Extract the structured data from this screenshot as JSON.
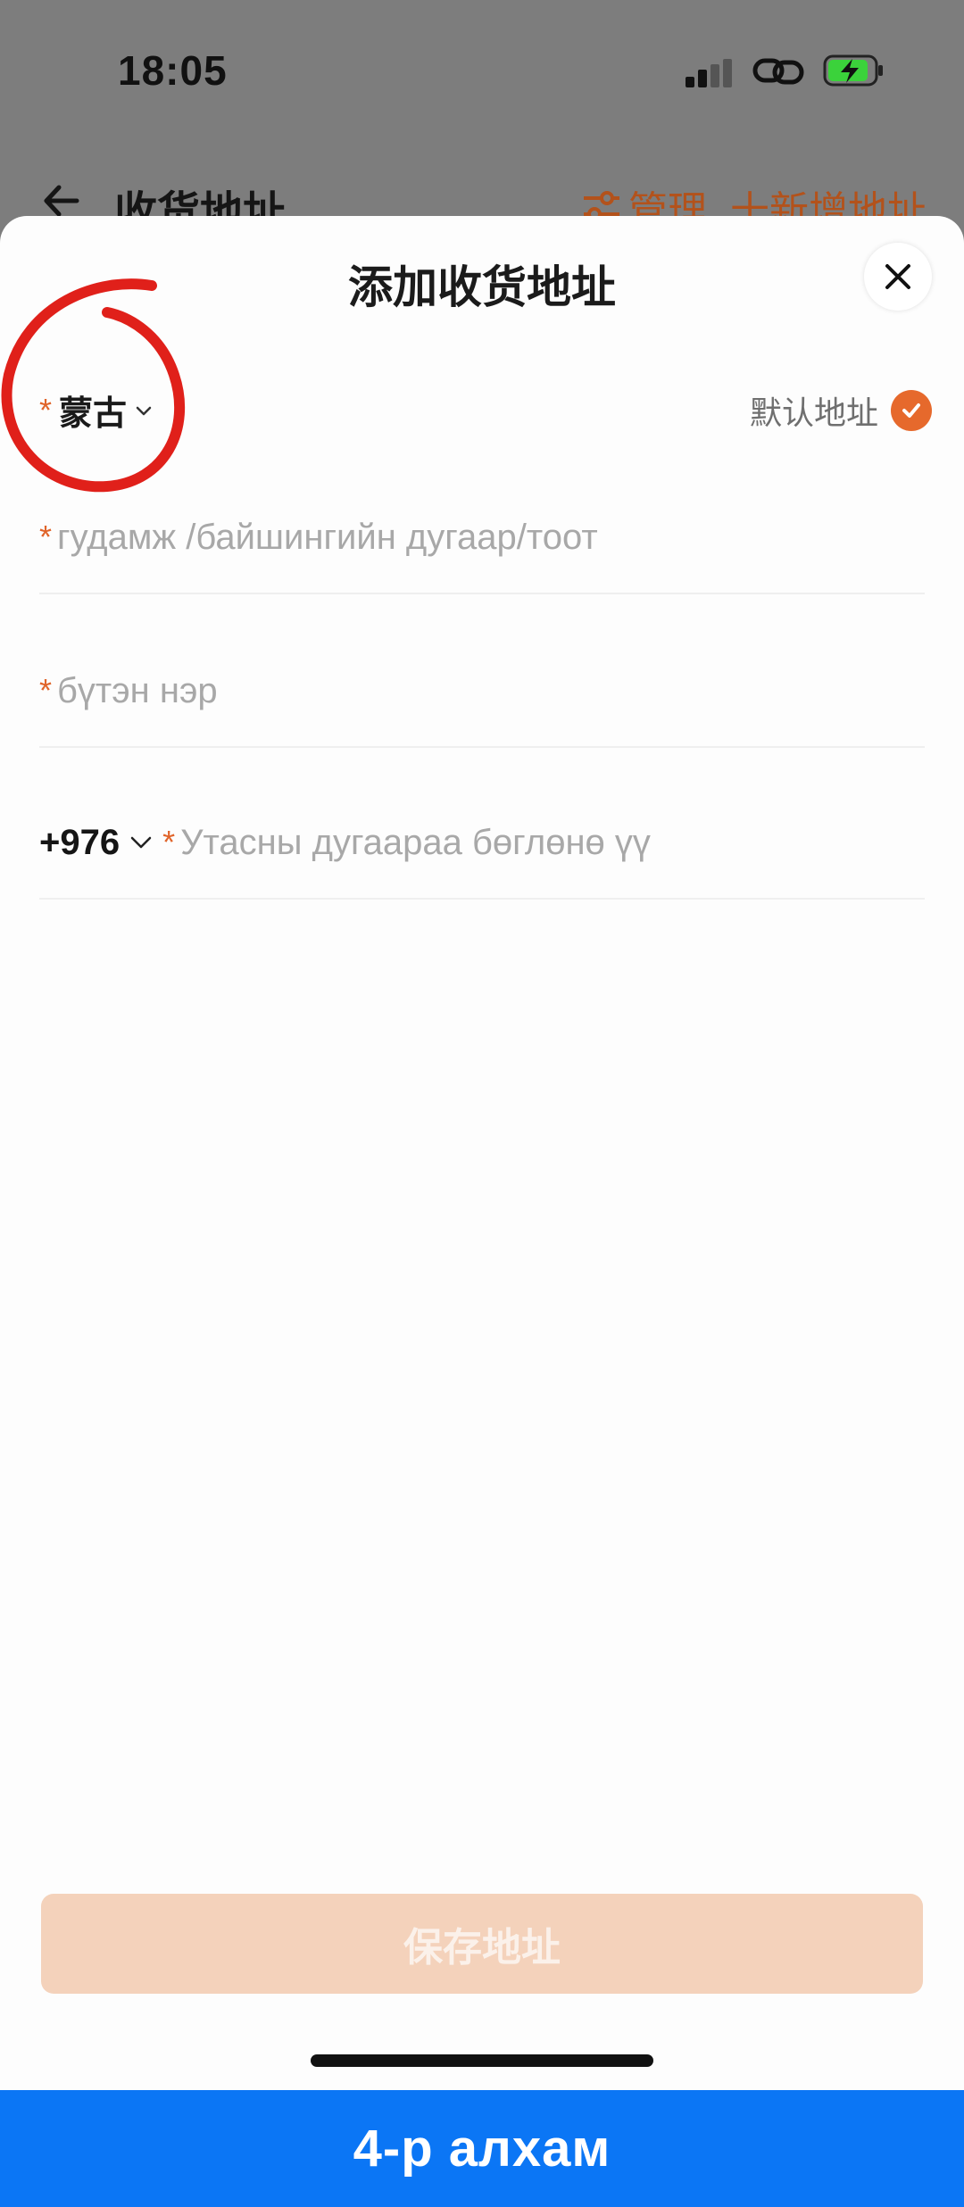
{
  "status_bar": {
    "time": "18:05"
  },
  "background_header": {
    "title": "收货地址",
    "manage_label": "管理",
    "add_label": "十新增地址"
  },
  "sheet": {
    "title": "添加收货地址",
    "region": {
      "required_mark": "*",
      "value": "蒙古"
    },
    "default_address": {
      "label": "默认地址",
      "checked": true
    },
    "fields": [
      {
        "required_mark": "*",
        "placeholder": "гудамж /байшингийн дугаар/тоот"
      },
      {
        "required_mark": "*",
        "placeholder": "бүтэн нэр"
      },
      {
        "country_code": "+976",
        "required_mark": "*",
        "placeholder": "Утасны дугаараа бөглөнө үү"
      }
    ],
    "save_button": "保存地址"
  },
  "step_banner": "4-р алхам",
  "colors": {
    "accent": "#e6692c",
    "save_button_bg": "#f4d2bb",
    "banner": "#0b76f5",
    "annotation": "#e0201a"
  }
}
